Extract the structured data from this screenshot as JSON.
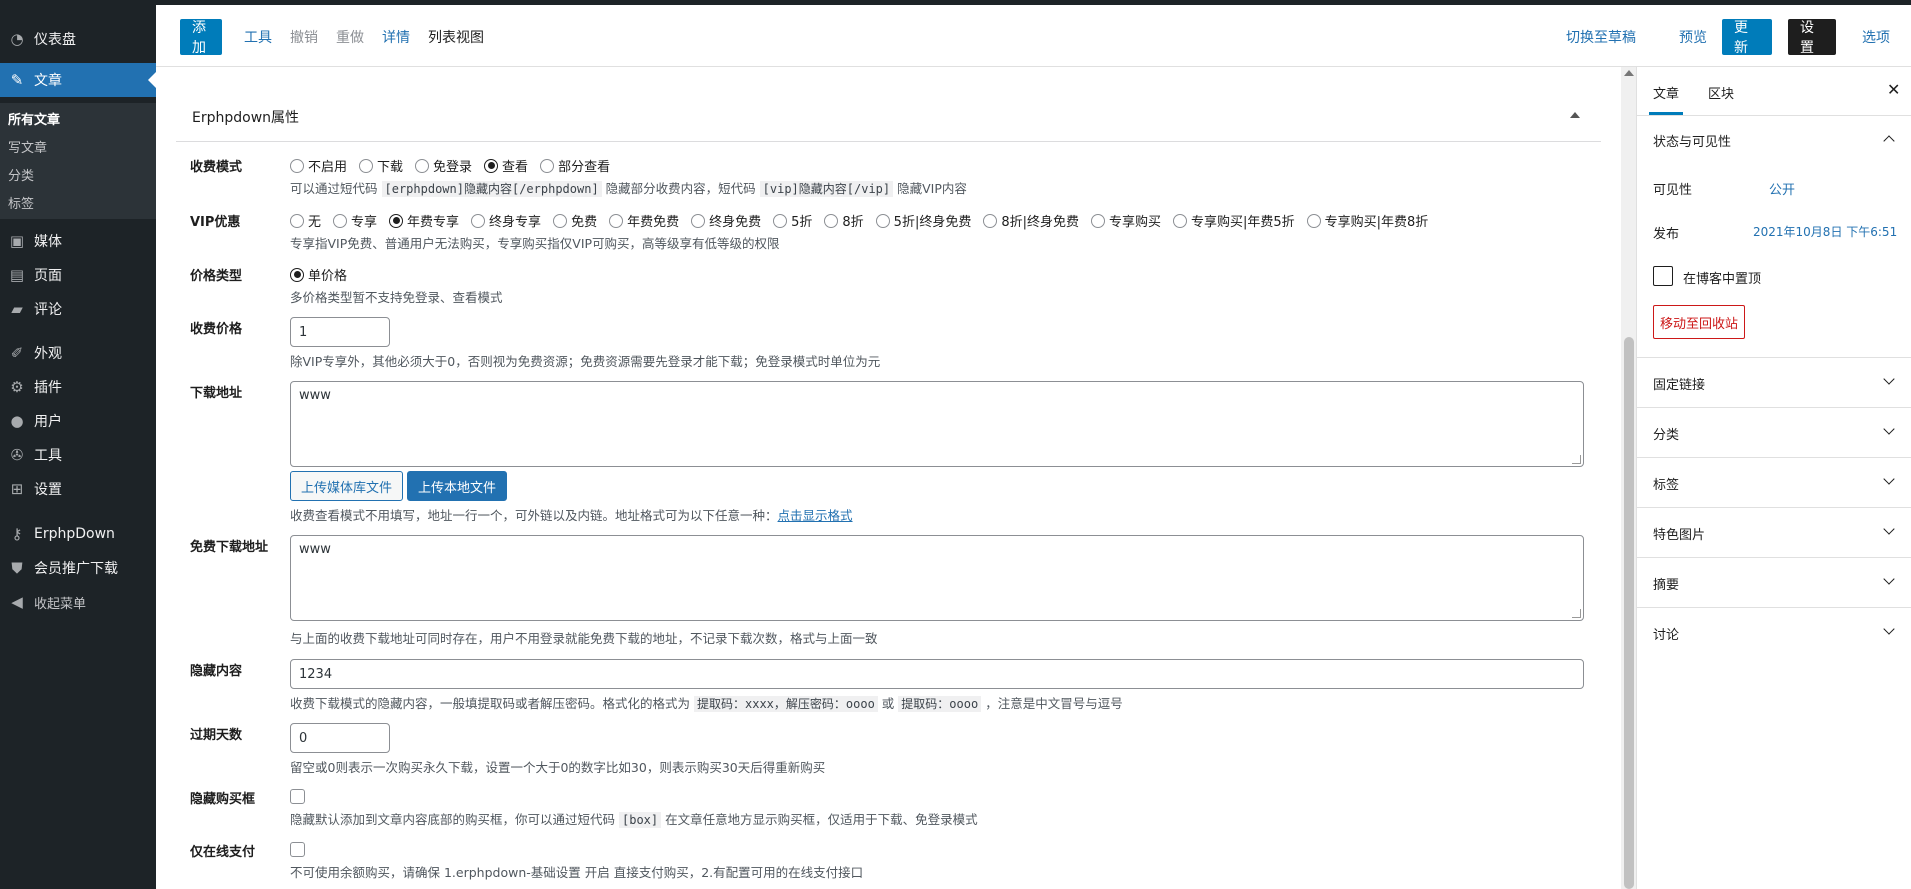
{
  "sidebar": {
    "items": [
      {
        "label": "仪表盘",
        "icon": "dashboard-icon"
      },
      {
        "label": "文章",
        "icon": "pin-icon"
      },
      {
        "label": "媒体",
        "icon": "media-icon"
      },
      {
        "label": "页面",
        "icon": "page-icon"
      },
      {
        "label": "评论",
        "icon": "comment-icon"
      },
      {
        "label": "外观",
        "icon": "appearance-icon"
      },
      {
        "label": "插件",
        "icon": "plugin-icon"
      },
      {
        "label": "用户",
        "icon": "user-icon"
      },
      {
        "label": "工具",
        "icon": "tools-icon"
      },
      {
        "label": "设置",
        "icon": "settings-icon"
      },
      {
        "label": "ErphpDown",
        "icon": "key-icon"
      },
      {
        "label": "会员推广下载",
        "icon": "shield-icon"
      },
      {
        "label": "收起菜单",
        "icon": "collapse-icon"
      }
    ],
    "submenu": [
      "所有文章",
      "写文章",
      "分类",
      "标签"
    ]
  },
  "toolbar": {
    "add": "添加",
    "tools": "工具",
    "undo": "撤销",
    "redo": "重做",
    "details": "详情",
    "list_view": "列表视图",
    "switch_draft": "切换至草稿",
    "preview": "预览",
    "update": "更新",
    "settings": "设置",
    "options": "选项"
  },
  "panel": {
    "title": "Erphpdown属性",
    "fee_mode": {
      "label": "收费模式",
      "options": [
        "不启用",
        "下载",
        "免登录",
        "查看",
        "部分查看"
      ],
      "selected": 3,
      "desc_a": "可以通过短代码",
      "code_a": "[erphpdown]隐藏内容[/erphpdown]",
      "desc_b": "隐藏部分收费内容，短代码",
      "code_b": "[vip]隐藏内容[/vip]",
      "desc_c": "隐藏VIP内容"
    },
    "vip": {
      "label": "VIP优惠",
      "options": [
        "无",
        "专享",
        "年费专享",
        "终身专享",
        "免费",
        "年费免费",
        "终身免费",
        "5折",
        "8折",
        "5折|终身免费",
        "8折|终身免费",
        "专享购买",
        "专享购买|年费5折",
        "专享购买|年费8折"
      ],
      "selected": 2,
      "desc": "专享指VIP免费、普通用户无法购买，专享购买指仅VIP可购买，高等级享有低等级的权限"
    },
    "price_type": {
      "label": "价格类型",
      "option": "单价格",
      "desc": "多价格类型暂不支持免登录、查看模式"
    },
    "price": {
      "label": "收费价格",
      "value": "1",
      "desc": "除VIP专享外，其他必须大于0，否则视为免费资源；免费资源需要先登录才能下载；免登录模式时单位为元"
    },
    "download": {
      "label": "下载地址",
      "value": "www",
      "upload_media": "上传媒体库文件",
      "upload_local": "上传本地文件",
      "desc": "收费查看模式不用填写，地址一行一个，可外链以及内链。地址格式可为以下任意一种：",
      "link": "点击显示格式"
    },
    "free_download": {
      "label": "免费下载地址",
      "value": "www",
      "desc": "与上面的收费下载地址可同时存在，用户不用登录就能免费下载的地址，不记录下载次数，格式与上面一致"
    },
    "hidden": {
      "label": "隐藏内容",
      "value": "1234",
      "desc_a": "收费下载模式的隐藏内容，一般填提取码或者解压密码。格式化的格式为",
      "code_a": "提取码：xxxx，解压密码：oooo",
      "desc_b": "或",
      "code_b": "提取码：oooo",
      "desc_c": "，注意是中文冒号与逗号"
    },
    "expire": {
      "label": "过期天数",
      "value": "0",
      "desc": "留空或0则表示一次购买永久下载，设置一个大于0的数字比如30，则表示购买30天后得重新购买"
    },
    "hide_box": {
      "label": "隐藏购买框",
      "desc_a": "隐藏默认添加到文章内容底部的购买框，你可以通过短代码",
      "code_a": "[box]",
      "desc_b": "在文章任意地方显示购买框，仅适用于下载、免登录模式"
    },
    "online_pay": {
      "label": "仅在线支付",
      "desc": "不可使用余额购买，请确保 1.erphpdown-基础设置 开启 直接支付购买，2.有配置可用的在线支付接口"
    }
  },
  "settings": {
    "tab_post": "文章",
    "tab_block": "区块",
    "status": {
      "title": "状态与可见性",
      "visibility_label": "可见性",
      "visibility_value": "公开",
      "publish_label": "发布",
      "publish_value": "2021年10月8日 下午6:51",
      "sticky": "在博客中置顶",
      "trash": "移动至回收站"
    },
    "sections": [
      "固定链接",
      "分类",
      "标签",
      "特色图片",
      "摘要",
      "讨论"
    ]
  }
}
